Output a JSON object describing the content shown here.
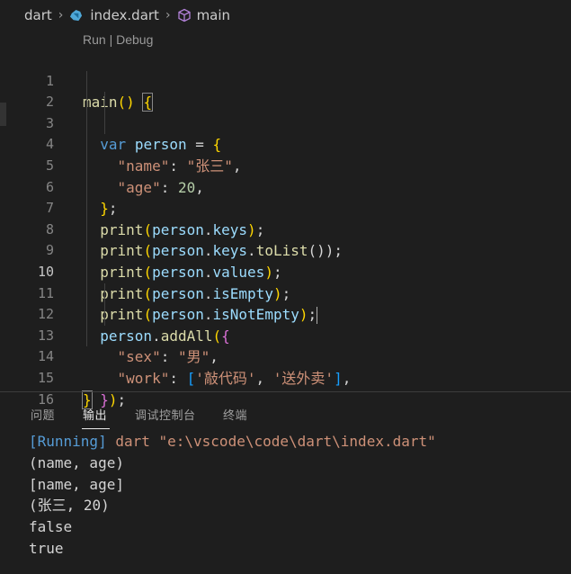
{
  "breadcrumb": {
    "folder": "dart",
    "file": "index.dart",
    "symbol": "main",
    "icons": [
      "dart-file-icon",
      "cube-icon"
    ]
  },
  "editor": {
    "codelens": "Run | Debug",
    "active_line": 10,
    "line_numbers": [
      "1",
      "2",
      "3",
      "4",
      "5",
      "6",
      "7",
      "8",
      "9",
      "10",
      "11",
      "12",
      "13",
      "14",
      "15",
      "16"
    ],
    "lines": [
      "main() {",
      "  var person = {",
      "    \"name\": \"张三\",",
      "    \"age\": 20,",
      "  };",
      "  print(person.keys);",
      "  print(person.keys.toList());",
      "  print(person.values);",
      "  print(person.isEmpty);",
      "  print(person.isNotEmpty);",
      "  person.addAll({",
      "    \"sex\": \"男\",",
      "    \"work\": ['敲代码', '送外卖'],",
      "  });",
      "}",
      ""
    ]
  },
  "panel": {
    "tabs": [
      "问题",
      "输出",
      "调试控制台",
      "终端"
    ],
    "active_tab": "输出",
    "output": {
      "running_tag": "[Running]",
      "running_cmd": " dart \"e:\\vscode\\code\\dart\\index.dart\"",
      "lines": [
        "(name, age)",
        "[name, age]",
        "(张三, 20)",
        "false",
        "true"
      ]
    }
  },
  "colors": {
    "background": "#1e1e1e",
    "keyword": "#569cd6",
    "variable": "#9cdcfe",
    "function": "#dcdcaa",
    "string": "#ce9178",
    "number": "#b5cea8",
    "brace": "#ffd700"
  }
}
